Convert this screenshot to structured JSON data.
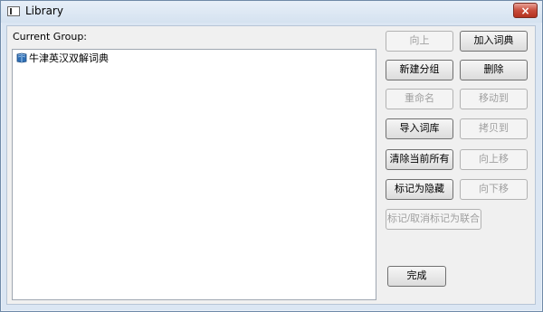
{
  "window": {
    "title": "Library",
    "close_label": "×"
  },
  "main": {
    "group_label": "Current Group:",
    "list_items": [
      {
        "label": "牛津英汉双解词典",
        "icon": "book-icon"
      }
    ]
  },
  "buttons": {
    "up": "向上",
    "add_dictionary": "加入词典",
    "new_group": "新建分组",
    "delete": "删除",
    "rename": "重命名",
    "move_to": "移动到",
    "import_lexicon": "导入词库",
    "copy_to": "拷贝到",
    "clear_all": "清除当前所有",
    "move_up": "向上移",
    "mark_hidden": "标记为隐藏",
    "move_down": "向下移",
    "toggle_union": "标记/取消标记为联合",
    "done": "完成"
  }
}
